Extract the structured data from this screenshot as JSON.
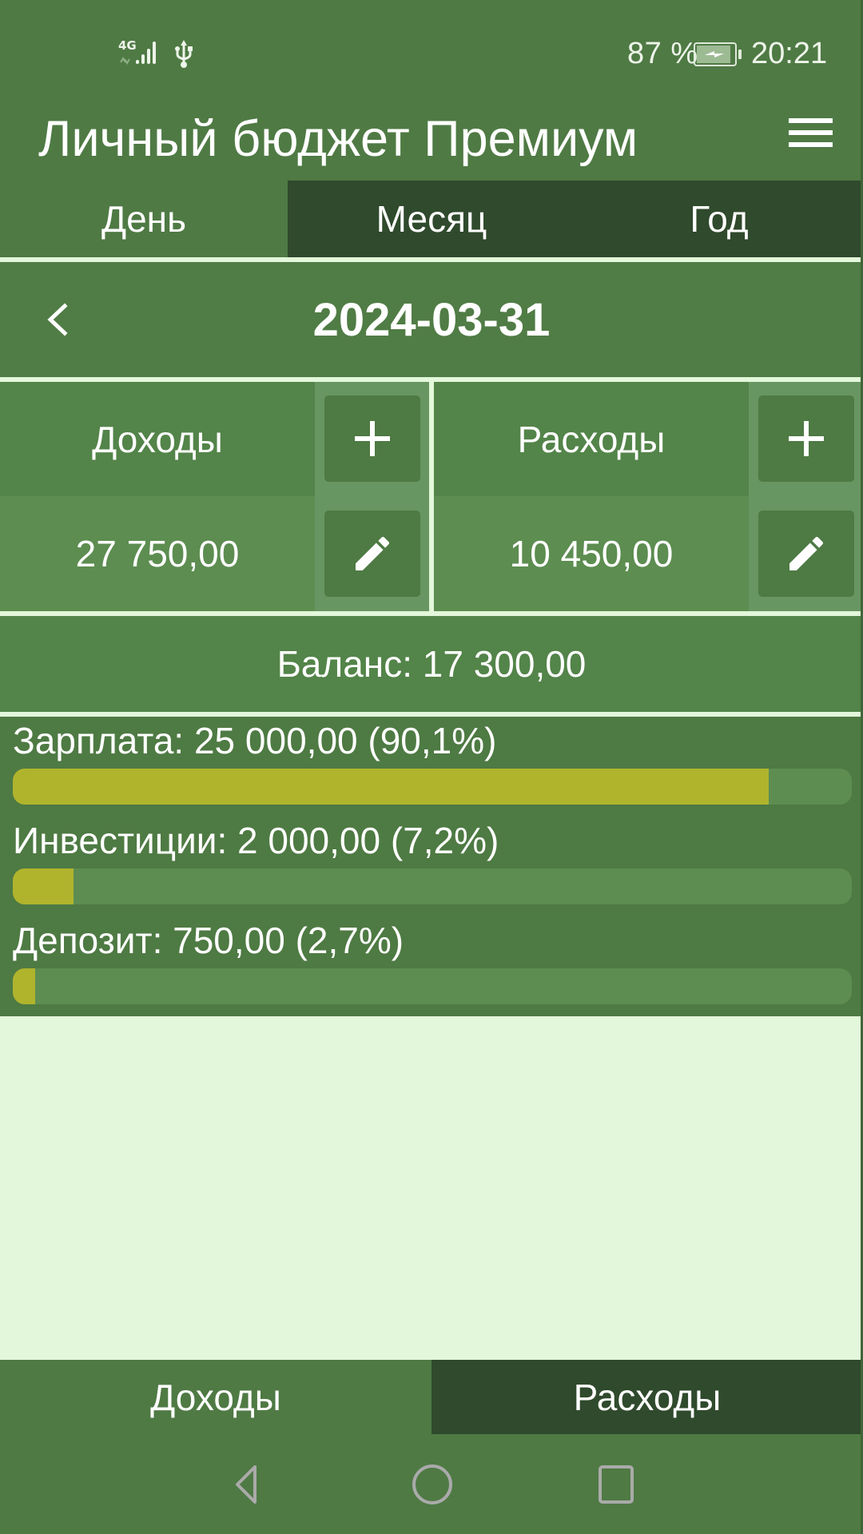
{
  "status_bar": {
    "network_type": "4G",
    "battery_percent": "87 %",
    "time": "20:21",
    "icons": [
      "signal-icon",
      "usb-icon",
      "battery-charging-icon"
    ]
  },
  "app": {
    "title": "Личный бюджет Премиум",
    "menu_icon": "hamburger-menu-icon"
  },
  "period_tabs": [
    {
      "label": "День",
      "active": true
    },
    {
      "label": "Месяц",
      "active": false
    },
    {
      "label": "Год",
      "active": false
    }
  ],
  "date_nav": {
    "date": "2024-03-31",
    "prev_icon": "chevron-left-icon"
  },
  "income_card": {
    "title": "Доходы",
    "amount": "27 750,00",
    "add_icon": "plus-icon",
    "edit_icon": "pencil-icon"
  },
  "expense_card": {
    "title": "Расходы",
    "amount": "10 450,00",
    "add_icon": "plus-icon",
    "edit_icon": "pencil-icon"
  },
  "balance": {
    "text": "Баланс: 17 300,00"
  },
  "categories": [
    {
      "label": "Зарплата: 25 000,00 (90,1%)",
      "name": "Зарплата",
      "amount": "25 000,00",
      "percent": 90.1
    },
    {
      "label": "Инвестиции: 2 000,00 (7,2%)",
      "name": "Инвестиции",
      "amount": "2 000,00",
      "percent": 7.2
    },
    {
      "label": "Депозит: 750,00 (2,7%)",
      "name": "Депозит",
      "amount": "750,00",
      "percent": 2.7
    }
  ],
  "bottom_tabs": [
    {
      "label": "Доходы",
      "active": true
    },
    {
      "label": "Расходы",
      "active": false
    }
  ],
  "nav_bar": {
    "icons": [
      "back-icon",
      "home-icon",
      "recents-icon"
    ]
  },
  "colors": {
    "primary": "#4f7a44",
    "dark_tab": "#2f4a2c",
    "background": "#e3f7da",
    "bar_fill": "#b0b42d",
    "bar_track": "#5d8d51"
  }
}
